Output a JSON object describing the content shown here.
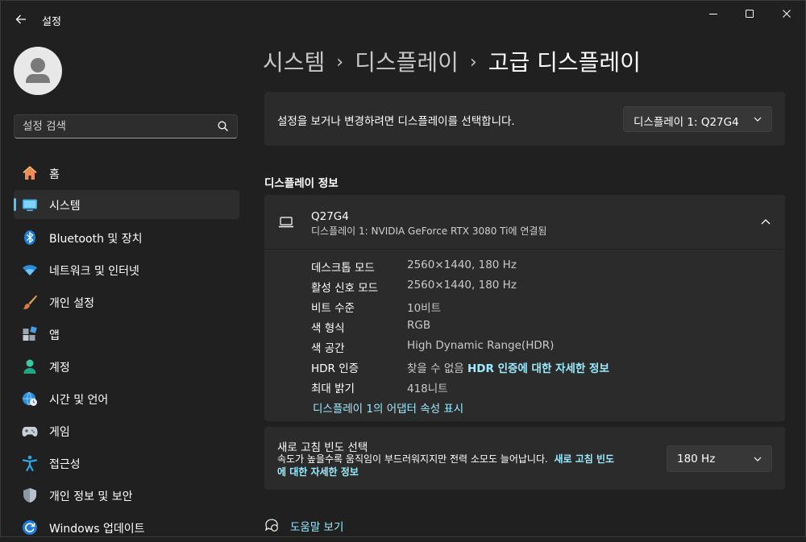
{
  "window": {
    "title": "설정",
    "minimize_glyph": "—",
    "maximize_glyph": "☐",
    "close_glyph": "✕"
  },
  "search": {
    "placeholder": "설정 검색"
  },
  "sidebar": {
    "items": [
      {
        "label": "홈",
        "icon": "home-icon"
      },
      {
        "label": "시스템",
        "icon": "system-icon",
        "active": true
      },
      {
        "label": "Bluetooth 및 장치",
        "icon": "bluetooth-icon"
      },
      {
        "label": "네트워크 및 인터넷",
        "icon": "wifi-icon"
      },
      {
        "label": "개인 설정",
        "icon": "brush-icon"
      },
      {
        "label": "앱",
        "icon": "apps-icon"
      },
      {
        "label": "계정",
        "icon": "account-icon"
      },
      {
        "label": "시간 및 언어",
        "icon": "globe-clock-icon"
      },
      {
        "label": "게임",
        "icon": "gamepad-icon"
      },
      {
        "label": "접근성",
        "icon": "accessibility-icon"
      },
      {
        "label": "개인 정보 및 보안",
        "icon": "shield-icon"
      },
      {
        "label": "Windows 업데이트",
        "icon": "update-icon"
      }
    ]
  },
  "breadcrumb": {
    "items": [
      "시스템",
      "디스플레이",
      "고급 디스플레이"
    ],
    "separator": "›"
  },
  "display_select": {
    "label": "설정을 보거나 변경하려면 디스플레이를 선택합니다.",
    "value": "디스플레이 1: Q27G4"
  },
  "display_info": {
    "section_title": "디스플레이 정보",
    "monitor_name": "Q27G4",
    "monitor_sub": "디스플레이 1: NVIDIA GeForce RTX 3080 Ti에 연결됨",
    "rows": [
      {
        "key": "데스크톱 모드",
        "value": "2560×1440, 180 Hz"
      },
      {
        "key": "활성 신호 모드",
        "value": "2560×1440, 180 Hz"
      },
      {
        "key": "비트 수준",
        "value": "10비트"
      },
      {
        "key": "색 형식",
        "value": "RGB"
      },
      {
        "key": "색 공간",
        "value": "High Dynamic Range(HDR)"
      },
      {
        "key": "HDR 인증",
        "value": "찾을 수 없음",
        "link": "HDR 인증에 대한 자세한 정보"
      },
      {
        "key": "최대 밝기",
        "value": "418니트"
      }
    ],
    "adapter_link": "디스플레이 1의 어댑터 속성 표시"
  },
  "refresh": {
    "title": "새로 고침 빈도 선택",
    "desc": "속도가 높을수록 움직임이 부드러워지지만 전력 소모도 늘어납니다.",
    "link_part1": "새로 고침 빈도",
    "link_part2": "에 대한 자세한 정보",
    "value": "180 Hz"
  },
  "help": {
    "label": "도움말 보기"
  },
  "colors": {
    "accent": "#4cc2ff",
    "link": "#99ebff",
    "background": "#202020",
    "card": "#2b2b2b"
  }
}
